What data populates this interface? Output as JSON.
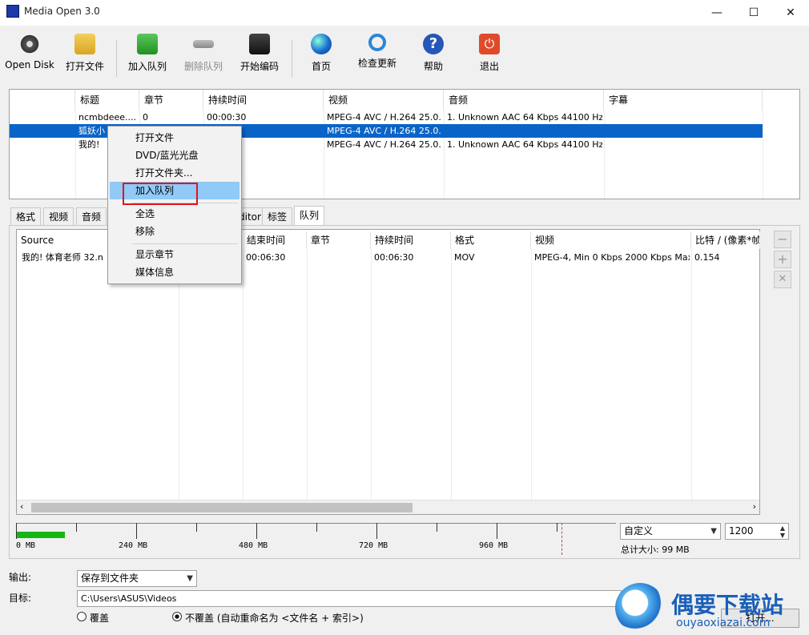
{
  "window": {
    "title": "Media Open 3.0",
    "minimize_glyph": "—",
    "maximize_glyph": "☐",
    "close_glyph": "✕"
  },
  "toolbar": [
    {
      "label": "Open Disk",
      "icon": "disc-icon"
    },
    {
      "label": "打开文件",
      "icon": "open-file-icon"
    },
    {
      "label": "加入队列",
      "icon": "add-queue-icon"
    },
    {
      "label": "删除队列",
      "icon": "remove-queue-icon"
    },
    {
      "label": "开始编码",
      "icon": "encode-icon"
    },
    {
      "label": "首页",
      "icon": "globe-icon"
    },
    {
      "label": "检查更新",
      "icon": "refresh-icon"
    },
    {
      "label": "帮助",
      "icon": "help-icon"
    },
    {
      "label": "退出",
      "icon": "power-icon"
    }
  ],
  "file_list": {
    "columns": [
      "标题",
      "章节",
      "持续时间",
      "视频",
      "音频",
      "字幕"
    ],
    "rows": [
      {
        "title": "ncmbdeee....",
        "chapter": "0",
        "duration": "00:00:30",
        "video": "MPEG-4 AVC / H.264 25.0...",
        "audio": "1. Unknown AAC  64 Kbps 44100 Hz ...",
        "subtitle": ""
      },
      {
        "title": "狐妖小",
        "chapter": "",
        "duration": "",
        "video": "MPEG-4 AVC / H.264 25.0...",
        "audio": "",
        "subtitle": ""
      },
      {
        "title": "我的!",
        "chapter": "",
        "duration": "",
        "video": "MPEG-4 AVC / H.264 25.0...",
        "audio": "1. Unknown AAC  64 Kbps 44100 Hz ...",
        "subtitle": ""
      }
    ]
  },
  "tabs": [
    "格式",
    "视频",
    "音频",
    "ditor",
    "标签",
    "队列"
  ],
  "queue": {
    "columns": [
      "Source",
      "结束时间",
      "章节",
      "持续时间",
      "格式",
      "视频",
      "比特 / (像素*帧"
    ],
    "rows": [
      {
        "source": "我的! 体育老师 32.n",
        "end": "00:06:30",
        "chapter": "",
        "duration": "00:06:30",
        "format": "MOV",
        "video": "MPEG-4, Min 0 Kbps 2000 Kbps Max ...",
        "bpp": "0.154"
      }
    ],
    "side_buttons": [
      "−",
      "+",
      "✕"
    ]
  },
  "capacity": {
    "labels": [
      "0 MB",
      "240 MB",
      "480 MB",
      "720 MB",
      "960 MB"
    ],
    "used_fraction": 0.08,
    "preset": "自定义",
    "size_value": "1200",
    "total_label": "总计大小: 99 MB"
  },
  "output": {
    "output_label": "输出:",
    "output_value": "保存到文件夹",
    "target_label": "目标:",
    "target_value": "C:\\Users\\ASUS\\Videos",
    "browse_label": "打开...",
    "overwrite_label": "覆盖",
    "no_overwrite_label": "不覆盖 (自动重命名为 <文件名 + 索引>)"
  },
  "context_menu": {
    "items": [
      "打开文件",
      "DVD/蓝光光盘",
      "打开文件夹...",
      "加入队列",
      "全选",
      "移除",
      "显示章节",
      "媒体信息"
    ],
    "highlighted": "加入队列"
  },
  "watermark": {
    "brand": "偶要下载站",
    "url": "ouyaoxiazai.com"
  },
  "colors": {
    "selection": "#0a64c8",
    "menu_highlight": "#91c9f7",
    "red_box": "#e0141e",
    "progress": "#14b814"
  }
}
